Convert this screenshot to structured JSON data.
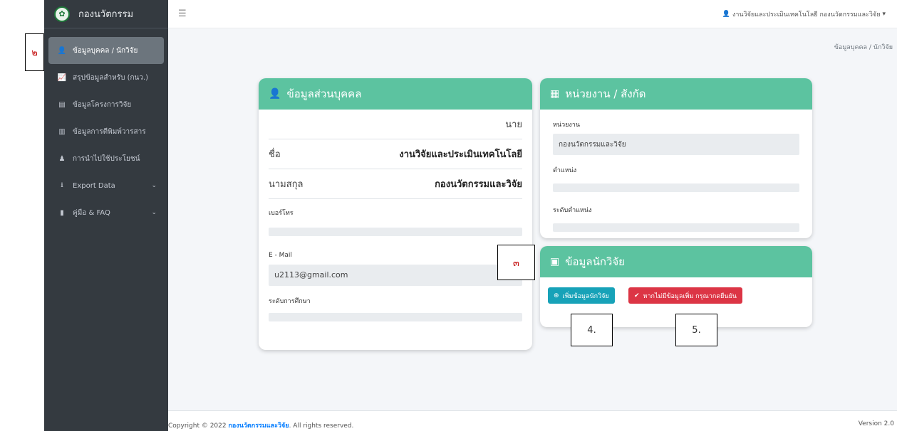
{
  "brand": {
    "title": "กองนวัตกรรม"
  },
  "sidebar": {
    "items": [
      {
        "label": "ข้อมูลบุคคล / นักวิจัย",
        "icon": "user-icon",
        "glyph": "👤"
      },
      {
        "label": "สรุปข้อมูลสำหรับ (กนว.)",
        "icon": "chart-line-icon",
        "glyph": "📈"
      },
      {
        "label": "ข้อมูลโครงการวิจัย",
        "icon": "book-icon",
        "glyph": "▤"
      },
      {
        "label": "ข้อมูลการตีพิมพ์วารสาร",
        "icon": "map-icon",
        "glyph": "▥"
      },
      {
        "label": "การนำไปใช้ประโยชน์",
        "icon": "child-icon",
        "glyph": "♟"
      },
      {
        "label": "Export Data",
        "icon": "download-icon",
        "glyph": "⭳"
      },
      {
        "label": "คู่มือ & FAQ",
        "icon": "bookmark-icon",
        "glyph": "▮"
      }
    ]
  },
  "topbar": {
    "user_name": "งานวิจัยและประเมินเทคโนโลยี กองนวัตกรรมและวิจัย"
  },
  "breadcrumb": "ข้อมูลบุคคล / นักวิจัย",
  "personal": {
    "title": "ข้อมูลส่วนบุคคล",
    "prefix": "นาย",
    "first_name_label": "ชื่อ",
    "first_name": "งานวิจัยและประเมินเทคโนโลยี",
    "last_name_label": "นามสกุล",
    "last_name": "กองนวัตกรรมและวิจัย",
    "phone_label": "เบอร์โทร",
    "phone": "",
    "email_label": "E - Mail",
    "email": "u2113@gmail.com",
    "education_label": "ระดับการศึกษา",
    "education": ""
  },
  "agency": {
    "title": "หน่วยงาน / สังกัด",
    "unit_label": "หน่วยงาน",
    "unit": "กองนวัตกรรมและวิจัย",
    "position_label": "ตำแหน่ง",
    "position": "",
    "level_label": "ระดับตำแหน่ง",
    "level": ""
  },
  "researcher": {
    "title": "ข้อมูลนักวิจัย",
    "add_button": "เพิ่มข้อมูลนักวิจัย",
    "confirm_button": "หากไม่มีข้อมูลเพิ่ม กรุณากดยืนยัน"
  },
  "annotations": {
    "a2": "๒",
    "a3": "๓",
    "a4": "4.",
    "a5": "5."
  },
  "footer": {
    "copyright_prefix": "Copyright © 2022 ",
    "org": "กองนวัตกรรมและวิจัย",
    "suffix": ". All rights reserved.",
    "version": "Version 2.0"
  },
  "colors": {
    "header_accent": "#5cc3a0",
    "sidebar_bg": "#343a40",
    "info": "#17a2b8",
    "danger": "#dc3545"
  }
}
